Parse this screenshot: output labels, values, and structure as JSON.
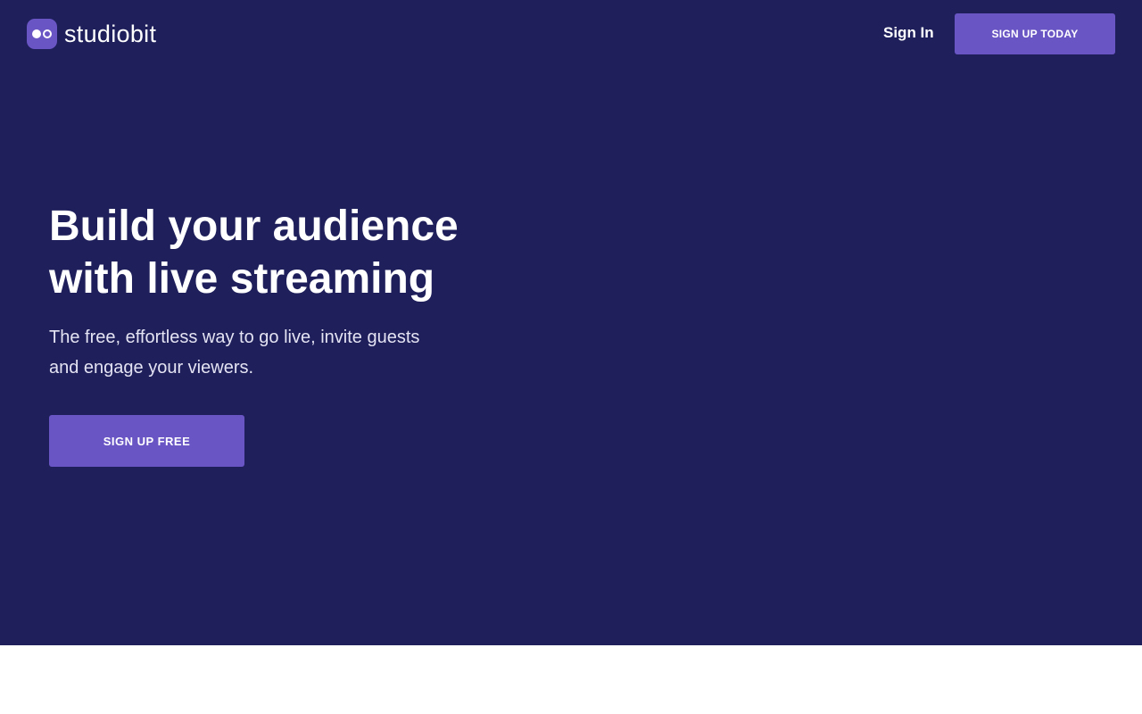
{
  "brand": {
    "name": "studiobit",
    "logo_icon": "studiobit-logo-icon",
    "accent_color": "#6a55c5",
    "hero_background": "#1e1f5b"
  },
  "nav": {
    "signin_label": "Sign In",
    "signup_label": "SIGN UP TODAY"
  },
  "hero": {
    "headline_line1": "Build your audience",
    "headline_line2": "with live streaming",
    "subheadline_line1": "The free, effortless way to go live, invite guests",
    "subheadline_line2": "and engage your viewers.",
    "cta_label": "SIGN UP FREE"
  }
}
